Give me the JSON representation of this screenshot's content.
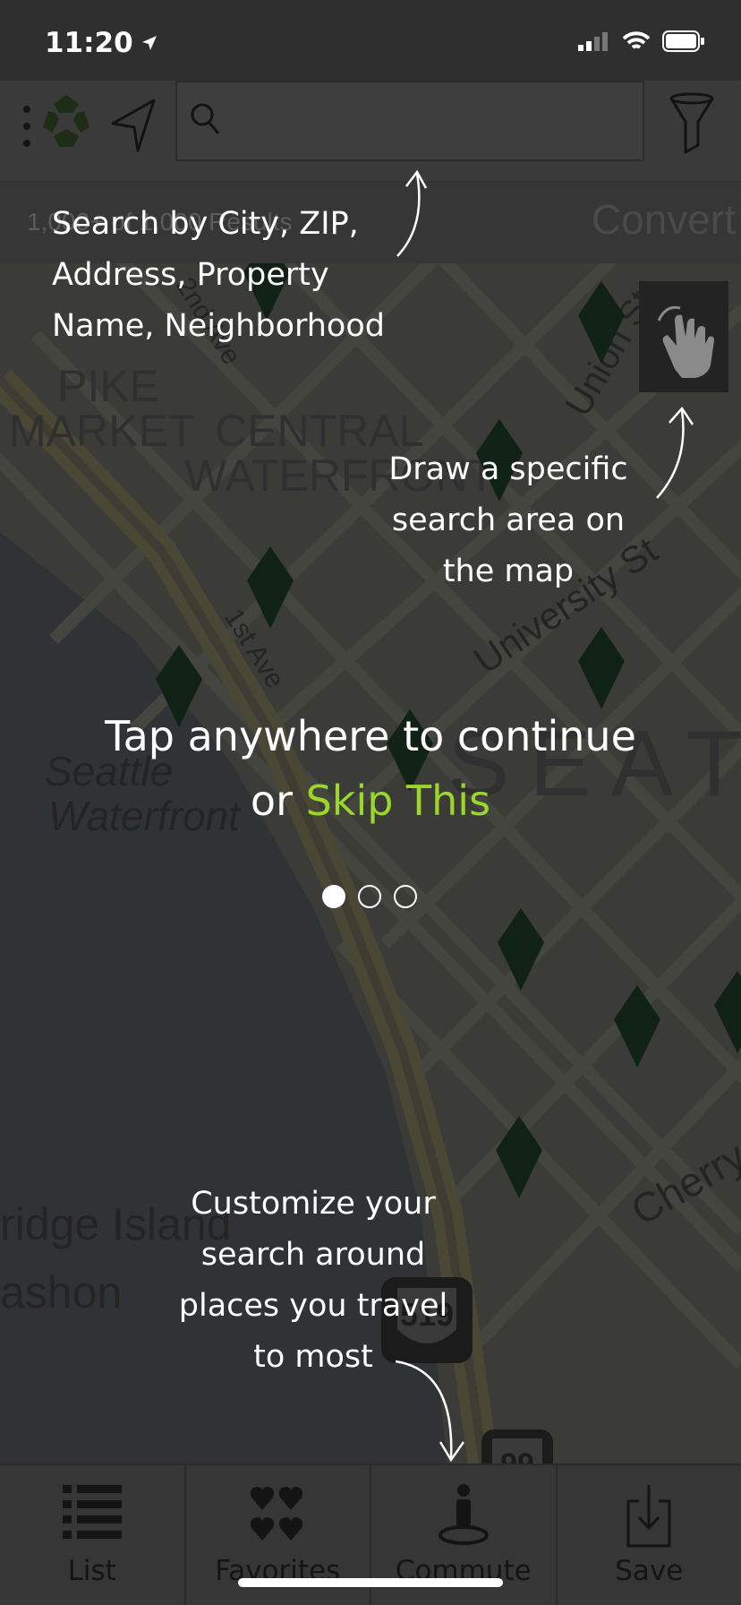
{
  "status_bar": {
    "time": "11:20"
  },
  "header": {
    "search": {
      "placeholder": "",
      "value": ""
    },
    "icons": [
      "menu-dots-icon",
      "logo-icon",
      "location-arrow-icon",
      "search-icon",
      "filter-funnel-icon"
    ]
  },
  "info_bar": {
    "result_count": "1,000+ of 1,000 Results",
    "right_label": "Convert"
  },
  "map": {
    "neighborhoods": [
      "PIKE",
      "MARKET",
      "CENTRAL",
      "WATERFRONT",
      "SEAT"
    ],
    "streets": [
      "1st Ave",
      "2nd Ave",
      "University St",
      "Union St",
      "Cherry",
      "Seattle",
      "Waterfront",
      "ridge Island",
      "ashon"
    ],
    "highway_shields": [
      "519",
      "99"
    ]
  },
  "coachmarks": {
    "search_hint": [
      "Search by City, ZIP,",
      "Address, Property",
      "Name, Neighborhood"
    ],
    "draw_hint": [
      "Draw a specific",
      "search area on",
      "the map"
    ],
    "commute_hint": [
      "Customize your",
      "search around",
      "places you travel",
      "to most"
    ],
    "tap_line": "Tap anywhere to continue",
    "or_text": "or",
    "skip_label": "Skip This",
    "page_dots": {
      "total": 3,
      "active": 1
    }
  },
  "tabbar": {
    "tabs": [
      {
        "label": "List",
        "icon": "list-icon"
      },
      {
        "label": "Favorites",
        "icon": "hearts-icon"
      },
      {
        "label": "Commute",
        "icon": "commute-person-icon"
      },
      {
        "label": "Save",
        "icon": "save-download-icon"
      }
    ]
  },
  "colors": {
    "accent_skip": "#9bd62a",
    "pin": "#0f2215",
    "overlay_text": "#ffffff"
  }
}
